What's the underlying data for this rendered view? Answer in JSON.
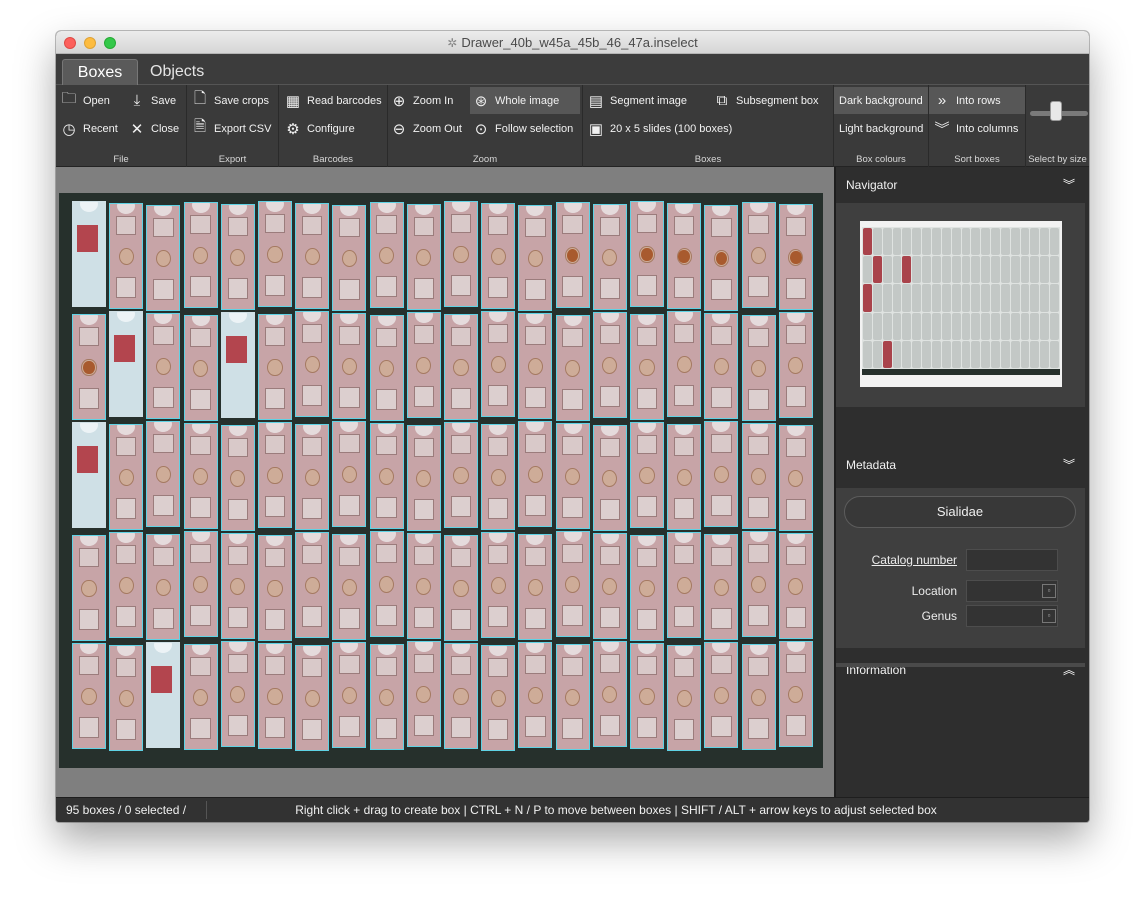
{
  "window": {
    "title": "Drawer_40b_w45a_45b_46_47a.inselect"
  },
  "tabs": [
    {
      "label": "Boxes",
      "active": true
    },
    {
      "label": "Objects",
      "active": false
    }
  ],
  "ribbon": {
    "file": {
      "label": "File",
      "open": "Open",
      "save": "Save",
      "recent": "Recent",
      "close": "Close"
    },
    "export": {
      "label": "Export",
      "save_crops": "Save crops",
      "export_csv": "Export CSV"
    },
    "barcodes": {
      "label": "Barcodes",
      "read_barcodes": "Read barcodes",
      "configure": "Configure"
    },
    "zoom": {
      "label": "Zoom",
      "zoom_in": "Zoom In",
      "zoom_out": "Zoom Out",
      "whole_image": "Whole image",
      "follow_selection": "Follow selection"
    },
    "boxes": {
      "label": "Boxes",
      "segment_image": "Segment image",
      "subsegment_box": "Subsegment box",
      "grid_preset": "20 x 5 slides (100 boxes)"
    },
    "box_colours": {
      "label": "Box colours",
      "dark": "Dark background",
      "light": "Light background"
    },
    "sort_boxes": {
      "label": "Sort boxes",
      "rows": "Into rows",
      "columns": "Into columns"
    },
    "select_by_size": {
      "label": "Select by size",
      "value": 0.5
    }
  },
  "panel": {
    "navigator": {
      "title": "Navigator"
    },
    "metadata": {
      "title": "Metadata",
      "template": "Sialidae",
      "fields": {
        "catalog_number": {
          "label": "Catalog number",
          "value": ""
        },
        "location": {
          "label": "Location",
          "value": ""
        },
        "genus": {
          "label": "Genus",
          "value": ""
        }
      }
    },
    "information": {
      "title": "Information"
    }
  },
  "status": {
    "count": "95 boxes / 0 selected /",
    "hint": "Right click + drag to create box  |  CTRL + N / P to move between boxes  |  SHIFT / ALT + arrow keys to adjust selected box"
  },
  "colors": {
    "box_outline": "#5fd2e4",
    "chrome_dark": "#2b2b2b",
    "ribbon": "#3a3a3a"
  },
  "icons": {
    "open": "folder-open-icon",
    "save": "download-icon",
    "recent": "clock-icon",
    "close": "close-icon",
    "save_crops": "page-add-icon",
    "export_csv": "csv-icon",
    "read_barcodes": "barcode-icon",
    "configure": "gear-icon",
    "zoom_in": "zoom-in-icon",
    "zoom_out": "zoom-out-icon",
    "whole_image": "zoom-fit-icon",
    "follow_selection": "zoom-follow-icon",
    "segment_image": "segment-icon",
    "subsegment_box": "subsegment-icon",
    "grid_preset": "grid-icon",
    "rows": "double-chevron-right-icon",
    "columns": "double-chevron-down-icon"
  }
}
